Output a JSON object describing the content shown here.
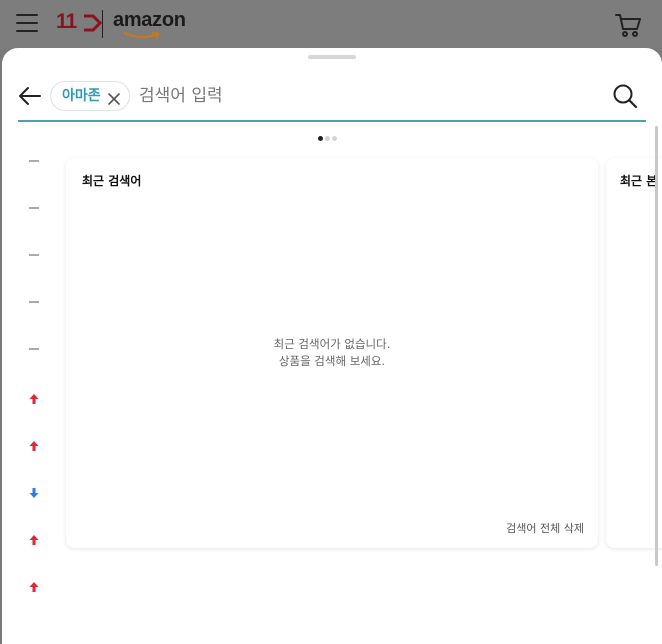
{
  "header": {
    "brand_11st": "11",
    "brand_amazon": "amazon"
  },
  "search": {
    "chip_label": "아마존",
    "placeholder": "검색어 입력",
    "value": ""
  },
  "pager": {
    "count": 3,
    "active_index": 0
  },
  "ranks": [
    {
      "trend": "same"
    },
    {
      "trend": "same"
    },
    {
      "trend": "same"
    },
    {
      "trend": "same"
    },
    {
      "trend": "same"
    },
    {
      "trend": "up"
    },
    {
      "trend": "up"
    },
    {
      "trend": "down"
    },
    {
      "trend": "up"
    },
    {
      "trend": "up"
    }
  ],
  "recent_search": {
    "title": "최근 검색어",
    "empty_line1": "최근 검색어가 없습니다.",
    "empty_line2": "상품을 검색해 보세요.",
    "delete_all_label": "검색어 전체 삭제"
  },
  "recent_viewed": {
    "title": "최근 본"
  },
  "colors": {
    "accent": "#4aa3b5",
    "chip_text": "#2f9bb3",
    "trend_up": "#e2263a",
    "trend_down": "#2a7fe0",
    "trend_same": "#aaaaaa",
    "brand_red": "#8a1320"
  },
  "icons": {
    "menu": "hamburger-icon",
    "cart": "cart-icon",
    "back": "back-arrow-icon",
    "clear_chip": "close-icon",
    "search": "search-icon"
  }
}
